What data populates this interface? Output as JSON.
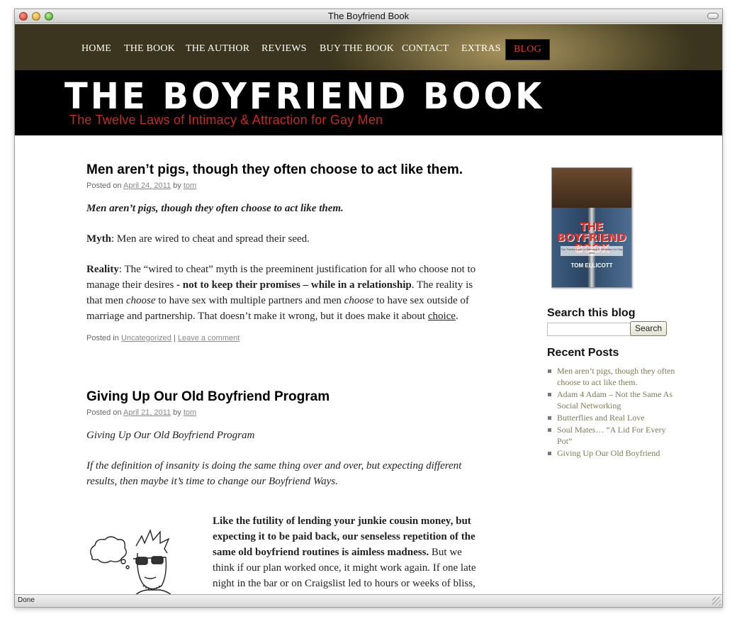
{
  "window": {
    "title": "The Boyfriend Book"
  },
  "nav": {
    "items": [
      {
        "label": "HOME"
      },
      {
        "label": "THE BOOK"
      },
      {
        "label": "THE AUTHOR"
      },
      {
        "label": "REVIEWS"
      },
      {
        "label": "BUY THE BOOK"
      },
      {
        "label": "CONTACT"
      },
      {
        "label": "EXTRAS"
      },
      {
        "label": "BLOG"
      }
    ],
    "active_color": "#e03a2e"
  },
  "header": {
    "site_title": "THE BOYFRIEND BOOK",
    "tagline": "The Twelve Laws of Intimacy & Attraction for Gay Men"
  },
  "posts": [
    {
      "title": "Men aren’t pigs, though they often choose to act like them.",
      "meta": {
        "posted_on": "Posted on",
        "date": "April 24, 2011",
        "by": "by",
        "author": "tom"
      },
      "intro": "Men aren’t pigs, though they often choose to act like them.",
      "myth_label": "Myth",
      "myth_text": ": Men are wired to cheat and spread their seed.",
      "reality_label": "Reality",
      "reality_1": ": The “wired to cheat” myth is the preeminent justification for all who choose not to manage their desires",
      "reality_bold": " - not to keep their promises – while in a relationship",
      "reality_2": ". The reality is that men",
      "reality_choose_1": "choose",
      "reality_3": "to have sex with multiple partners and men",
      "reality_choose_2": "choose",
      "reality_4": "to have sex outside of marriage and partnership. That doesn’t make it wrong, but it does make it about",
      "reality_link": "choice",
      "reality_end": ".",
      "footer": {
        "posted_in": "Posted in",
        "category": "Uncategorized",
        "sep": "|",
        "comment": "Leave a comment"
      }
    },
    {
      "title": "Giving Up Our Old Boyfriend Program",
      "meta": {
        "posted_on": "Posted on",
        "date": "April 21, 2011",
        "by": "by",
        "author": "tom"
      },
      "intro": "Giving Up Our Old Boyfriend Program",
      "quote": "If the definition of insanity is doing the same thing over and over, but expecting different results, then maybe it’s time to change our Boyfriend Ways.",
      "bold_text": "Like the futility of lending your junkie cousin money, but expecting it to be paid back, our senseless repetition of the same old boyfriend routines is aimless madness.",
      "body_text": " But we think if our plan worked once, it might work again. If one late night in the bar or on Craigslist led to hours or weeks of bliss, then it"
    }
  ],
  "sidebar": {
    "book_cover": {
      "title": "THE BOYFRIEND BOOK",
      "subtitle": "The Twelve Laws of Intimacy & Attraction for Gay Men",
      "author": "TOM ELLICOTT"
    },
    "search": {
      "title": "Search this blog",
      "placeholder": "",
      "button": "Search"
    },
    "recent": {
      "title": "Recent Posts",
      "items": [
        "Men aren’t pigs, though they often choose to act like them.",
        "Adam 4 Adam – Not the Same As Social Networking",
        "Butterflies and Real Love",
        "Soul Mates… “A Lid For Every Pot”",
        "Giving Up Our Old Boyfriend"
      ]
    }
  },
  "status": {
    "text": "Done"
  },
  "colors": {
    "nav_gold": "#7e6f44",
    "tagline_red": "#c62a22",
    "link_olive": "#7d7a55"
  }
}
